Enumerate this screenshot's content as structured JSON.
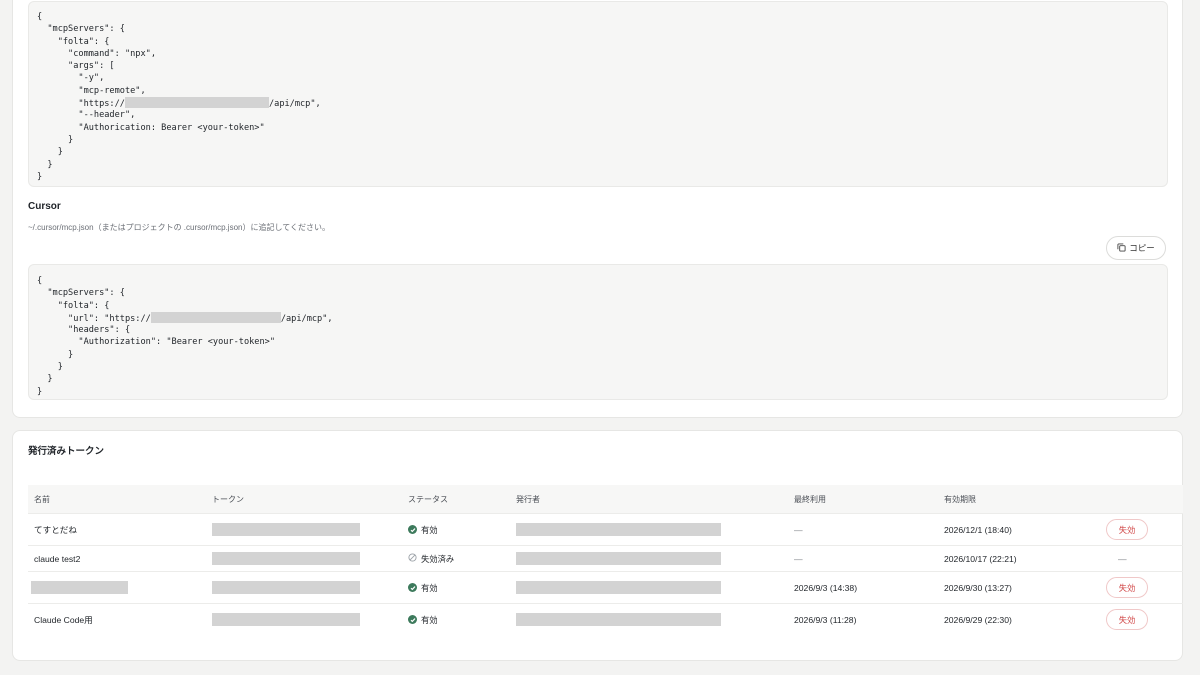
{
  "claude_code_config": {
    "lines": [
      {
        "pre": "{",
        "post": ""
      },
      {
        "pre": "  \"mcpServers\": {",
        "post": ""
      },
      {
        "pre": "    \"folta\": {",
        "post": ""
      },
      {
        "pre": "      \"command\": \"npx\",",
        "post": ""
      },
      {
        "pre": "      \"args\": [",
        "post": ""
      },
      {
        "pre": "        \"-y\",",
        "post": ""
      },
      {
        "pre": "        \"mcp-remote\",",
        "post": ""
      },
      {
        "pre": "        \"https://",
        "post": "/api/mcp\","
      },
      {
        "pre": "        \"--header\",",
        "post": ""
      },
      {
        "pre": "        \"Authorication: Bearer <your-token>\"",
        "post": ""
      },
      {
        "pre": "      }",
        "post": ""
      },
      {
        "pre": "    }",
        "post": ""
      },
      {
        "pre": "  }",
        "post": ""
      },
      {
        "pre": "}",
        "post": ""
      }
    ]
  },
  "cursor_section": {
    "title": "Cursor",
    "description": "~/.cursor/mcp.json（またはプロジェクトの .cursor/mcp.json）に追記してください。",
    "copy_label": "コピー",
    "lines": [
      {
        "pre": "{",
        "post": ""
      },
      {
        "pre": "  \"mcpServers\": {",
        "post": ""
      },
      {
        "pre": "    \"folta\": {",
        "post": ""
      },
      {
        "pre": "      \"url\": \"https://",
        "post": "/api/mcp\","
      },
      {
        "pre": "      \"headers\": {",
        "post": ""
      },
      {
        "pre": "        \"Authorization\": \"Bearer <your-token>\"",
        "post": ""
      },
      {
        "pre": "      }",
        "post": ""
      },
      {
        "pre": "    }",
        "post": ""
      },
      {
        "pre": "  }",
        "post": ""
      },
      {
        "pre": "}",
        "post": ""
      }
    ]
  },
  "tokens": {
    "title": "発行済みトークン",
    "columns": {
      "name": "名前",
      "token": "トークン",
      "status": "ステータス",
      "issuer": "発行者",
      "last_used": "最終利用",
      "expires": "有効期限"
    },
    "rows": [
      {
        "name": "てすとだね",
        "status": "有効",
        "active": true,
        "last_used": "—",
        "expires": "2026/12/1 (18:40)",
        "action": "失効"
      },
      {
        "name": "claude test2",
        "status": "失効済み",
        "active": false,
        "last_used": "—",
        "expires": "2026/10/17 (22:21)",
        "action": "—"
      },
      {
        "name": "",
        "status": "有効",
        "active": true,
        "last_used": "2026/9/3 (14:38)",
        "expires": "2026/9/30 (13:27)",
        "action": "失効"
      },
      {
        "name": "Claude Code用",
        "status": "有効",
        "active": true,
        "last_used": "2026/9/3 (11:28)",
        "expires": "2026/9/29 (22:30)",
        "action": "失効"
      }
    ]
  },
  "colors": {
    "active_status": "#3d7a5c",
    "revoke_text": "#d14848",
    "redaction": "#d3d3d3"
  }
}
